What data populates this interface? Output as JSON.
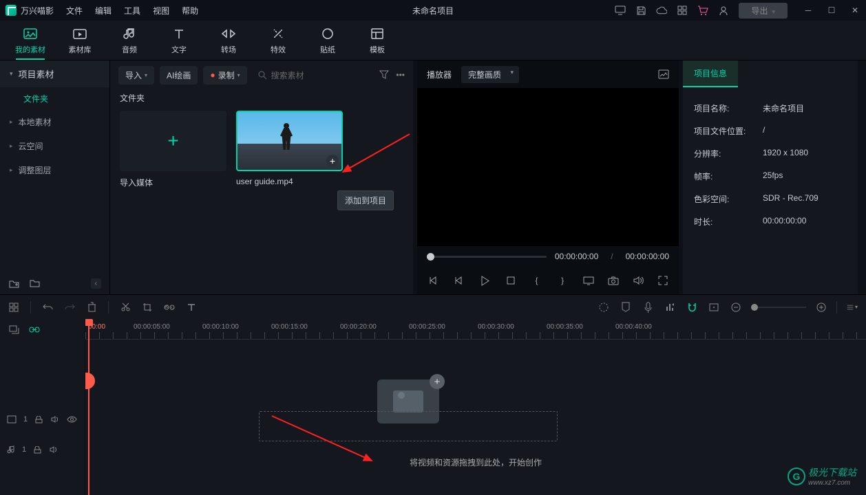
{
  "app": {
    "name": "万兴喵影",
    "project_title": "未命名项目",
    "export": "导出"
  },
  "menu": [
    "文件",
    "编辑",
    "工具",
    "视图",
    "帮助"
  ],
  "tabs": [
    {
      "id": "my-media",
      "label": "我的素材"
    },
    {
      "id": "library",
      "label": "素材库"
    },
    {
      "id": "audio",
      "label": "音频"
    },
    {
      "id": "text",
      "label": "文字"
    },
    {
      "id": "transition",
      "label": "转场"
    },
    {
      "id": "effect",
      "label": "特效"
    },
    {
      "id": "sticker",
      "label": "贴纸"
    },
    {
      "id": "template",
      "label": "模板"
    }
  ],
  "sidebar": {
    "header": "项目素材",
    "sub": "文件夹",
    "items": [
      "本地素材",
      "云空间",
      "调整图层"
    ]
  },
  "media_toolbar": {
    "import": "导入",
    "ai": "AI绘画",
    "record": "录制",
    "search_placeholder": "搜索素材"
  },
  "media": {
    "section": "文件夹",
    "import_label": "导入媒体",
    "clip_name": "user guide.mp4",
    "tooltip": "添加到项目"
  },
  "player": {
    "title": "播放器",
    "quality": "完整画质",
    "current": "00:00:00:00",
    "total": "00:00:00:00"
  },
  "info": {
    "tab": "项目信息",
    "rows": [
      {
        "k": "项目名称:",
        "v": "未命名项目"
      },
      {
        "k": "项目文件位置:",
        "v": "/"
      },
      {
        "k": "分辨率:",
        "v": "1920 x 1080"
      },
      {
        "k": "帧率:",
        "v": "25fps"
      },
      {
        "k": "色彩空间:",
        "v": "SDR - Rec.709"
      },
      {
        "k": "时长:",
        "v": "00:00:00:00"
      }
    ]
  },
  "timeline": {
    "ruler_start": "00:00",
    "marks": [
      "00:00:05:00",
      "00:00:10:00",
      "00:00:15:00",
      "00:00:20:00",
      "00:00:25:00",
      "00:00:30:00",
      "00:00:35:00",
      "00:00:40:00"
    ],
    "drop_text": "将视频和资源拖拽到此处，开始创作"
  },
  "watermark": "极光下载站",
  "watermark_url": "www.xz7.com"
}
